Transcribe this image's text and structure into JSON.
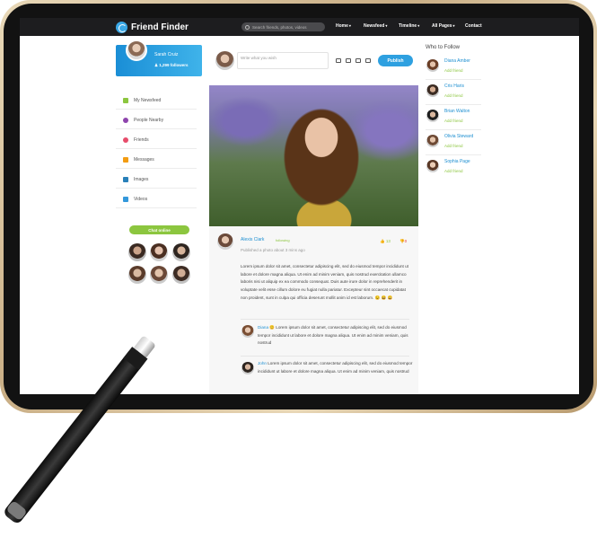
{
  "app": {
    "name": "Friend Finder"
  },
  "search": {
    "placeholder": "Search friends, photos, videos"
  },
  "nav": {
    "home": "Home",
    "newsfeed": "Newsfeed",
    "timeline": "Timeline",
    "all_pages": "All Pages",
    "contact": "Contact"
  },
  "profile": {
    "name": "Sarah Cruiz",
    "followers": "1,299 followers"
  },
  "sidebar": {
    "items": [
      {
        "label": "My Newsfeed",
        "icon": "newspaper-icon"
      },
      {
        "label": "People Nearby",
        "icon": "people-icon"
      },
      {
        "label": "Friends",
        "icon": "friends-icon"
      },
      {
        "label": "Messages",
        "icon": "chat-icon"
      },
      {
        "label": "Images",
        "icon": "image-icon"
      },
      {
        "label": "Videos",
        "icon": "video-icon"
      }
    ],
    "chat_label": "Chat online"
  },
  "composer": {
    "placeholder": "Write what you wish",
    "publish_label": "Publish"
  },
  "post": {
    "author": "Alexis Clark",
    "follow_status": "following",
    "meta": "Published a photo about 3 mins ago",
    "likes": "13",
    "dislikes": "0",
    "text": "Lorem ipsum dolor sit amet, consectetur adipiscing elit, sed do eiusmod tempor incididunt ut labore et dolore magna aliqua. Ut enim ad minim veniam, quis nostrud exercitation ullamco laboris nisi ut aliquip ex ea commodo consequat. Duis aute irure dolor in reprehenderit in voluptate velit esse cillum dolore eu fugiat nulla pariatur. Excepteur sint occaecat cupidatat non proident, sunt in culpa qui officia deserunt mollit anim id est laborum. 😉 😆 😄"
  },
  "comments": [
    {
      "author": "Diana",
      "text": "😊 Lorem ipsum dolor sit amet, consectetur adipiscing elit, sed do eiusmod tempor incididunt ut labore et dolore magna aliqua. Ut enim ad minim veniam, quis nostrud"
    },
    {
      "author": "John",
      "text": "Lorem ipsum dolor sit amet, consectetur adipiscing elit, sed do eiusmod tempor incididunt ut labore et dolore magna aliqua. Ut enim ad minim veniam, quis nostrud"
    }
  ],
  "who_to_follow": {
    "title": "Who to Follow",
    "add_label": "Add friend",
    "people": [
      {
        "name": "Diana Amber"
      },
      {
        "name": "Cris Haris"
      },
      {
        "name": "Brian Walton"
      },
      {
        "name": "Olivia Steward"
      },
      {
        "name": "Sophia Page"
      }
    ]
  },
  "colors": {
    "accent": "#2ea0e0",
    "green": "#8cc63f",
    "topbar": "#1d1d1f",
    "frame": "#c9ae85"
  }
}
